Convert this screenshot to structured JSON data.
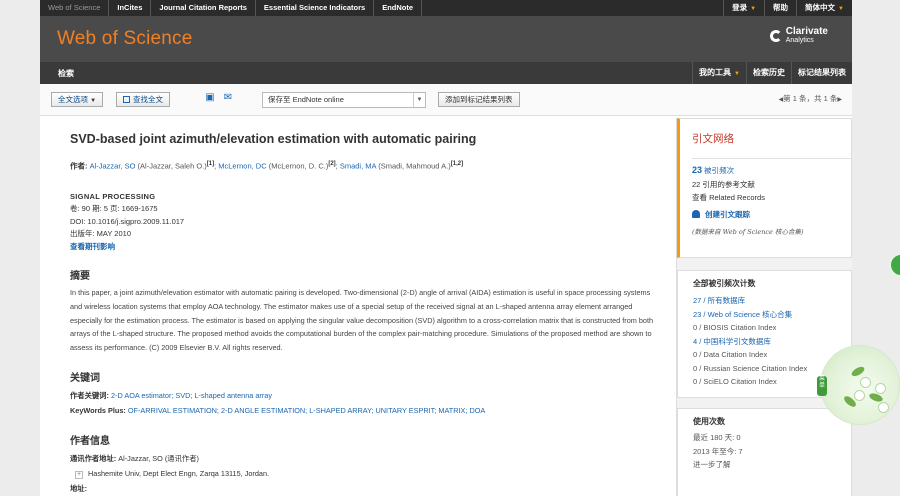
{
  "topnav": {
    "items": [
      "Web of Science",
      "InCites",
      "Journal Citation Reports",
      "Essential Science Indicators",
      "EndNote"
    ],
    "right": {
      "login": "登录",
      "help": "帮助",
      "language": "简体中文"
    }
  },
  "brand": {
    "logo": "Web of Science",
    "clarivate_line1": "Clarivate",
    "clarivate_line2": "Analytics"
  },
  "subnav": {
    "search": "检索",
    "my_tools": "我的工具",
    "search_history": "检索历史",
    "marked_list": "标记结果列表"
  },
  "toolbar": {
    "full_text_options": "全文选项",
    "find_full_text": "查找全文",
    "save_to": "保存至 EndNote online",
    "add_to_marked": "添加到标记结果列表",
    "pager": "第 1 条，共 1 条"
  },
  "record": {
    "title": "SVD-based joint azimuth/elevation estimation with automatic pairing",
    "authors_label": "作者:",
    "authors": [
      {
        "name": "Al-Jazzar, SO",
        "full": "(Al-Jazzar, Saleh O.)",
        "sup": "[1]"
      },
      {
        "name": "McLernon, DC",
        "full": "(McLernon, D. C.)",
        "sup": "[2]"
      },
      {
        "name": "Smadi, MA",
        "full": "(Smadi, Mahmoud A.)",
        "sup": "[1,2]"
      }
    ],
    "journal": "SIGNAL PROCESSING",
    "volume_line": "卷: 90 期: 5 页: 1669-1675",
    "doi_line": "DOI: 10.1016/j.sigpro.2009.11.017",
    "pub_year_line": "出版年: MAY 2010",
    "impact_link": "查看期刊影响",
    "abstract_heading": "摘要",
    "abstract": "In this paper, a joint azimuth/elevation estimator with automatic pairing is developed. Two-dimensional (2-D) angle of arrival (AIDA) estimation is useful in space processing systems and wireless location systems that employ AOA technology. The estimator makes use of a special setup of the received signal at an L-shaped antenna array element arranged especially for the estimation process. The estimator is based on applying the singular value decomposition (SVD) algorithm to a cross-correlation matrix that is constructed from both arrays of the L-shaped structure. The proposed method avoids the computational burden of the complex pair-matching procedure. Simulations of the proposed method are shown to assess its performance. (C) 2009 Elsevier B.V. All rights reserved.",
    "keywords_heading": "关键词",
    "author_kw_label": "作者关键词:",
    "author_kw": "2-D AOA estimator; SVD; L-shaped antenna array",
    "kwplus_label": "KeyWords Plus:",
    "kwplus": "OF-ARRIVAL ESTIMATION; 2-D ANGLE ESTIMATION; L-SHAPED ARRAY; UNITARY ESPRIT; MATRIX; DOA",
    "author_info_heading": "作者信息",
    "corr_label": "通讯作者地址:",
    "corr_value": "Al-Jazzar, SO (通讯作者)",
    "corr_address": "Hashemite Univ, Dept Elect Engn, Zarqa 13115, Jordan.",
    "address_label": "地址:"
  },
  "sidebar": {
    "citation_network": "引文网络",
    "times_cited_num": "23",
    "times_cited_label": "被引频次",
    "refs": "22 引用的参考文献",
    "related": "查看 Related Records",
    "create_alert": "创建引文跟踪",
    "data_note": "(数据来自 Web of Science 核心合集)",
    "all_counts_heading": "全部被引频次计数",
    "counts": [
      {
        "num": "27",
        "label": " / 所有数据库",
        "link": true
      },
      {
        "num": "23",
        "label": " / Web of Science 核心合集",
        "link": true
      },
      {
        "num": "0",
        "label": " / BIOSIS Citation Index",
        "link": false
      },
      {
        "num": "4",
        "label": " / 中国科学引文数据库",
        "link": true
      },
      {
        "num": "0",
        "label": " / Data Citation Index",
        "link": false
      },
      {
        "num": "0",
        "label": " / Russian Science Citation Index",
        "link": false
      },
      {
        "num": "0",
        "label": " / SciELO Citation Index",
        "link": false
      }
    ],
    "usage_heading": "使用次数",
    "usage_180": "最近 180 天: 0",
    "usage_2013": "2013 年至今: 7",
    "learn_more": "进一步了解"
  },
  "overlay": {
    "tag_text": "菜单"
  }
}
